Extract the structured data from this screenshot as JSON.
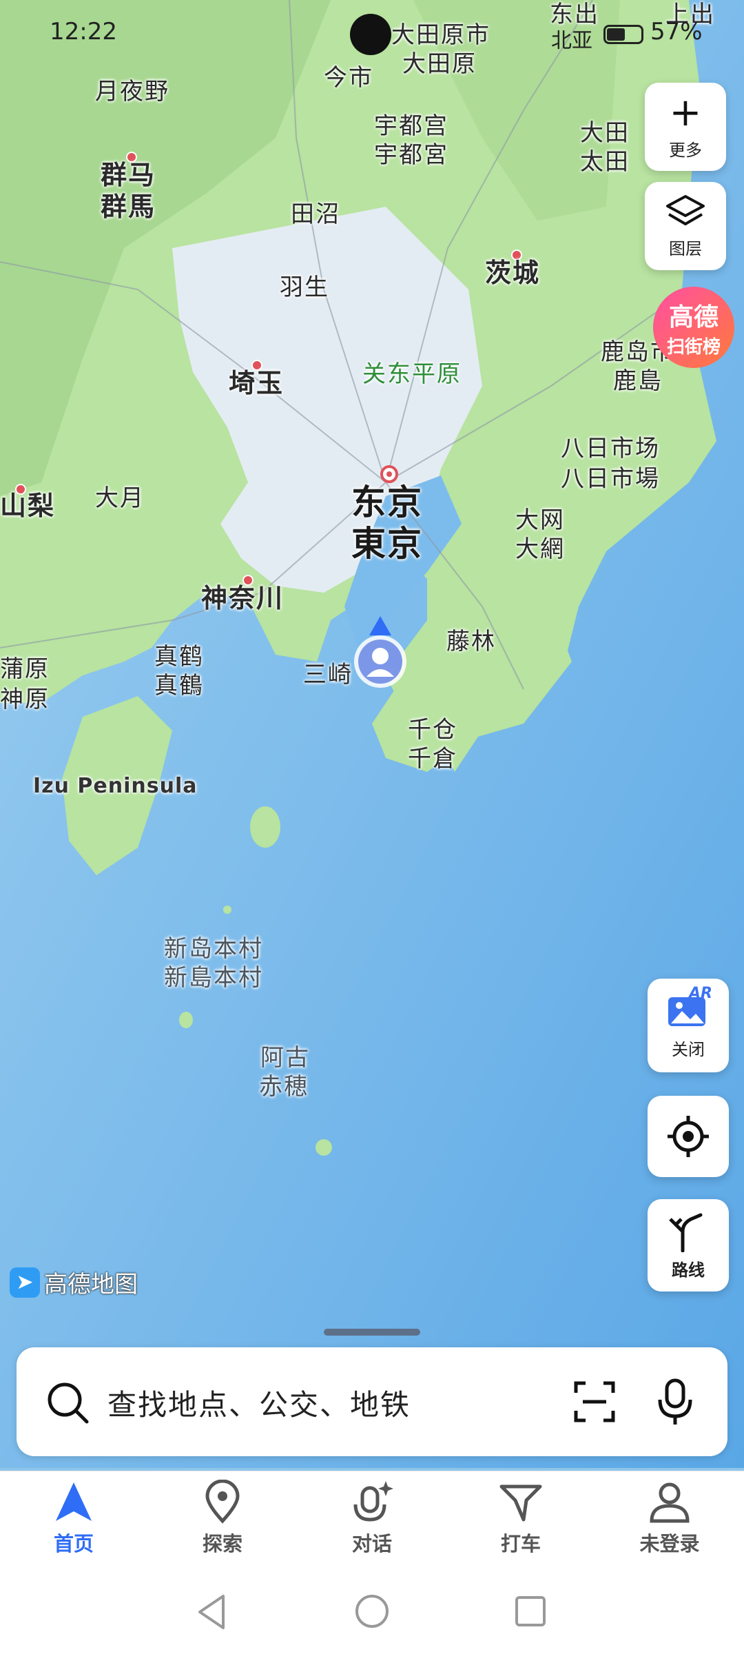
{
  "status_bar": {
    "time": "12:22",
    "battery": "57%"
  },
  "map_labels": {
    "gunma_cn": "群马",
    "gunma_jp": "群馬",
    "ota_cn": "大田原市",
    "ota_jp": "大田原",
    "imaichi": "今市",
    "utsunomiya_cn": "宇都宫",
    "utsunomiya_jp": "宇都宮",
    "tsukiyono": "月夜野",
    "numata": "田沼",
    "hanyu": "羽生",
    "ibaraki": "茨城",
    "kanto_plain": "关东平原",
    "saitama": "埼玉",
    "kashima_cn": "鹿岛市",
    "kashima_jp": "鹿島",
    "yokaichiba_cn": "八日市场",
    "yokaichiba_jp": "八日市場",
    "yamanashi": "山梨",
    "otsuki": "大月",
    "tokyo_cn": "东京",
    "tokyo_jp": "東京",
    "oami_cn": "大网",
    "oami_jp": "大網",
    "kanagawa": "神奈川",
    "mobara": "藤林",
    "manazuru_cn": "真鹤",
    "manazuru_jp": "真鶴",
    "miura": "三崎",
    "kamagaya_cn": "蒲原",
    "kamagaya_jp": "神原",
    "chikura_cn": "千仓",
    "chikura_jp": "千倉",
    "izu": "Izu Peninsula",
    "niijima_cn": "新岛本村",
    "niijima_jp": "新島本村",
    "ako_cn": "阿古",
    "ako_jp": "赤穂",
    "daigo_cn": "大田",
    "daigo_jp": "太田",
    "top_right_1": "东出",
    "top_right_2": "上出",
    "top_right_3": "北亚"
  },
  "side_buttons": {
    "more": "更多",
    "layers": "图层",
    "promo_line1": "高德",
    "promo_line2": "扫街榜",
    "ar_badge": "AR",
    "ar_close": "关闭",
    "route": "路线"
  },
  "brand": "高德地图",
  "search": {
    "placeholder": "查找地点、公交、地铁"
  },
  "tabs": [
    {
      "label": "首页",
      "icon": "navigation-arrow-icon",
      "active": true
    },
    {
      "label": "探索",
      "icon": "location-pin-icon"
    },
    {
      "label": "对话",
      "icon": "microphone-sparkle-icon"
    },
    {
      "label": "打车",
      "icon": "taxi-flag-icon"
    },
    {
      "label": "未登录",
      "icon": "user-icon"
    }
  ],
  "colors": {
    "accent": "#2f6df6",
    "land": "#b8e3a0",
    "sea": "#6fb6ea",
    "urban": "#e4ecf3"
  }
}
